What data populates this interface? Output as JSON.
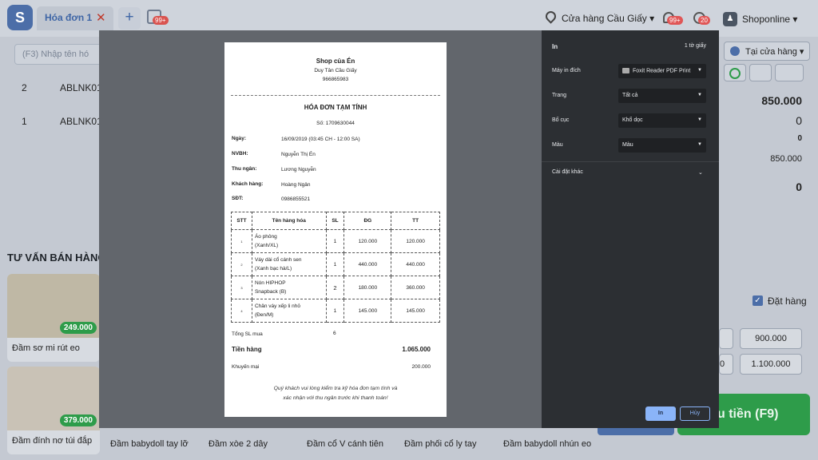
{
  "app": {
    "logo": "S"
  },
  "tabs": {
    "active": "Hóa đơn 1",
    "close": "✕",
    "add": "+",
    "invoice_badge": "99+"
  },
  "header": {
    "store": "Cửa hàng Cầu Giấy",
    "notif_badge": "99+",
    "history_badge": "20",
    "user": "Shoponline"
  },
  "search": {
    "placeholder": "(F3) Nhập tên hó"
  },
  "order_rows": [
    {
      "no": "2",
      "code": "ABLNK01-"
    },
    {
      "no": "1",
      "code": "ABLNK01-"
    }
  ],
  "section_title": "TƯ VẤN BÁN HÀNG",
  "products": [
    {
      "name": "Đầm sơ mi rút eo",
      "price": "249.000"
    },
    {
      "name": "Đầm đính nơ túi đắp",
      "price": "379.000"
    }
  ],
  "bottom_products": [
    "Đầm babydoll tay lỡ",
    "Đầm xòe 2 dây",
    "Đầm cổ V cánh tiên",
    "Đầm phối cổ ly tay",
    "Đầm babydoll nhún eo"
  ],
  "right": {
    "store_button": "Tại cửa hàng",
    "total": "850.000",
    "v1": "0",
    "v2": "0",
    "v3": "850.000",
    "v4": "0",
    "order_check": "Đặt hàng",
    "quick_a": "900.000",
    "quick_b": "1.100.000",
    "quick_c": "0",
    "pay": "u tiền (F9)"
  },
  "receipt": {
    "shop": "Shop của Én",
    "address": "Duy Tân Cầu Giấy",
    "phone": "966865983",
    "title": "HÓA ĐƠN TẠM TÍNH",
    "number": "Số: 1709630044",
    "fields": [
      {
        "label": "Ngày:",
        "value": "16/09/2019 (03:45 CH - 12:00 SA)"
      },
      {
        "label": "NVBH:",
        "value": "Nguyễn Thị Én"
      },
      {
        "label": "Thu ngân:",
        "value": "Lương Nguyễn"
      },
      {
        "label": "Khách hàng:",
        "value": "Hoàng Ngân"
      },
      {
        "label": "SĐT:",
        "value": "0986855521"
      }
    ],
    "headers": {
      "stt": "STT",
      "name": "Tên hàng hóa",
      "qty": "SL",
      "price": "ĐG",
      "total": "TT"
    },
    "items": [
      {
        "stt": "1",
        "name1": "Áo phông",
        "name2": "(Xanh/XL)",
        "qty": "1",
        "price": "120.000",
        "total": "120.000"
      },
      {
        "stt": "2",
        "name1": "Váy dài cổ cánh sen",
        "name2": "(Xanh bạc hà/L)",
        "qty": "1",
        "price": "440.000",
        "total": "440.000"
      },
      {
        "stt": "3",
        "name1": "Nón HIPHOP",
        "name2": "Snapback (B)",
        "qty": "2",
        "price": "180.000",
        "total": "360.000"
      },
      {
        "stt": "4",
        "name1": "Chân váy xếp li nhỏ",
        "name2": "(Đen/M)",
        "qty": "1",
        "price": "145.000",
        "total": "145.000"
      }
    ],
    "total_qty_label": "Tổng SL mua",
    "total_qty": "6",
    "subtotal_label": "Tiền hàng",
    "subtotal": "1.065.000",
    "discount_label": "Khuyến mại",
    "discount": "200.000",
    "note1": "Quý khách vui lòng kiểm tra kỹ hóa đơn tạm tính và",
    "note2": "xác nhận với thu ngân trước khi thanh toán!"
  },
  "print": {
    "title": "In",
    "sheets": "1 tờ giấy",
    "dest_label": "Máy in đích",
    "dest": "Foxit Reader PDF Print",
    "pages_label": "Trang",
    "pages": "Tất cả",
    "layout_label": "Bố cục",
    "layout": "Khổ dọc",
    "color_label": "Màu",
    "color": "Màu",
    "more": "Cài đặt khác",
    "print_btn": "In",
    "cancel_btn": "Hủy"
  }
}
